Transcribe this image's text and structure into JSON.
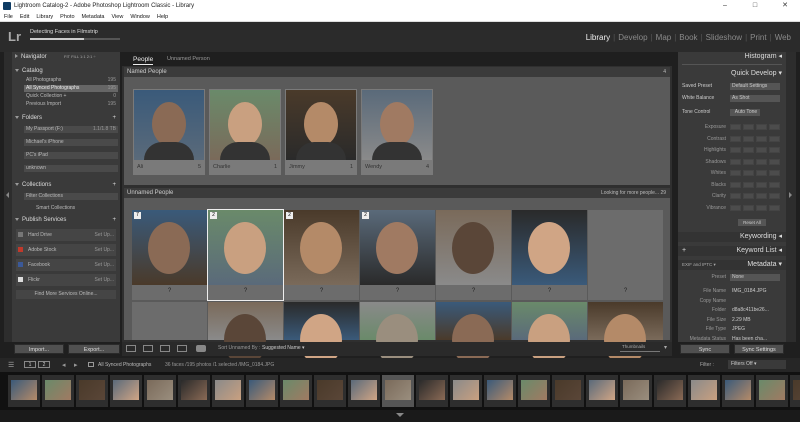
{
  "window": {
    "title": "Lightroom Catalog-2 - Adobe Photoshop Lightroom Classic - Library"
  },
  "menu": [
    "File",
    "Edit",
    "Library",
    "Photo",
    "Metadata",
    "View",
    "Window",
    "Help"
  ],
  "logo": "Lr",
  "activity": {
    "text": "Detecting Faces in Filmstrip",
    "progress": 0.6
  },
  "modules": [
    "Library",
    "Develop",
    "Map",
    "Book",
    "Slideshow",
    "Print",
    "Web"
  ],
  "active_module": "Library",
  "left": {
    "navigator": {
      "title": "Navigator",
      "zoom": [
        "FIT",
        "FILL",
        "1:1",
        "2:1 ÷"
      ]
    },
    "catalog": {
      "title": "Catalog",
      "items": [
        {
          "label": "All Photographs",
          "count": "195"
        },
        {
          "label": "All Synced Photographs",
          "count": "195"
        },
        {
          "label": "Quick Collection +",
          "count": "0"
        },
        {
          "label": "Previous Import",
          "count": "195"
        }
      ]
    },
    "folders": {
      "title": "Folders",
      "items": [
        {
          "label": "My Passport (F:)",
          "count": "1.1/1.8 TB"
        },
        {
          "label": "Michael's iPhone",
          "count": ""
        },
        {
          "label": "PC's iPad",
          "count": ""
        },
        {
          "label": "unknown",
          "count": ""
        }
      ]
    },
    "collections": {
      "title": "Collections",
      "items": [
        "Filter Collections",
        "Smart Collections"
      ]
    },
    "publish": {
      "title": "Publish Services",
      "items": [
        {
          "label": "Hard Drive",
          "action": "Set Up..."
        },
        {
          "label": "Adobe Stock",
          "action": "Set Up..."
        },
        {
          "label": "Facebook",
          "action": "Set Up..."
        },
        {
          "label": "Flickr",
          "action": "Set Up..."
        }
      ],
      "find_more": "Find More Services Online..."
    },
    "import_label": "Import...",
    "export_label": "Export..."
  },
  "center": {
    "tabs": [
      "People",
      "Unnamed Person"
    ],
    "named": {
      "title": "Named People",
      "count": "4",
      "people": [
        {
          "name": "Ali",
          "count": "5"
        },
        {
          "name": "Charlie",
          "count": "1"
        },
        {
          "name": "Jimmy",
          "count": "1"
        },
        {
          "name": "Wendy",
          "count": "4"
        }
      ]
    },
    "unnamed": {
      "title": "Unnamed People",
      "status": "Looking for more people...",
      "count": "29",
      "badges": [
        "7",
        "2",
        "2",
        "2",
        "",
        "",
        ""
      ],
      "question": "?"
    },
    "toolbar": {
      "sort_label": "Sort Unnamed By :",
      "sort_value": "Suggested Name",
      "thumbnails": "Thumbnails"
    }
  },
  "right": {
    "histogram": "Histogram",
    "quick_develop": "Quick Develop",
    "saved_preset": {
      "label": "Saved Preset",
      "value": "Default Settings"
    },
    "white_balance": {
      "label": "White Balance",
      "value": "As Shot"
    },
    "tone_control": {
      "label": "Tone Control",
      "value": "Auto Tone"
    },
    "adjustments": [
      "Exposure",
      "Contrast",
      "Highlights",
      "Shadows",
      "Whites",
      "Blacks",
      "Clarity",
      "Vibrance"
    ],
    "reset_all": "Reset All",
    "keywording": "Keywording",
    "keyword_list": "Keyword List",
    "metadata": "Metadata",
    "metadata_preset": {
      "label": "EXIF and IPTC",
      "preset_label": "Preset",
      "preset_value": "None"
    },
    "fields": [
      {
        "label": "File Name",
        "value": "IMG_0184.JPG"
      },
      {
        "label": "Copy Name",
        "value": ""
      },
      {
        "label": "Folder",
        "value": "d8a8c411be26..."
      },
      {
        "label": "File Size",
        "value": "2.29 MB"
      },
      {
        "label": "File Type",
        "value": "JPEG"
      },
      {
        "label": "Metadata Status",
        "value": "Has been cha..."
      }
    ],
    "sync_label": "Sync",
    "sync_settings_label": "Sync Settings"
  },
  "filmstrip": {
    "pages": [
      "1",
      "2"
    ],
    "source": "All Synced Photographs",
    "info": "36 faces /195 photos /1 selected /IMG_0184.JPG",
    "filter_label": "Filter :",
    "filter_value": "Filters Off",
    "thumb_count": 25,
    "selected_index": 11
  },
  "colors": {
    "accent": "#eeeeee",
    "panel": "#3a3a3a",
    "grid": "#5a5a5a"
  }
}
